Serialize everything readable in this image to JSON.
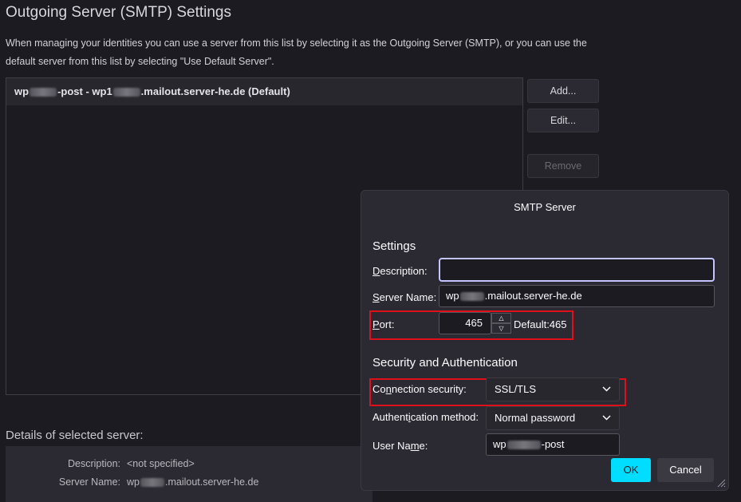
{
  "page": {
    "title": "Outgoing Server (SMTP) Settings",
    "intro": "When managing your identities you can use a server from this list by selecting it as the Outgoing Server (SMTP), or you can use the default server from this list by selecting \"Use Default Server\"."
  },
  "server_list": {
    "items": [
      {
        "prefix": "wp",
        "mid": "-post - wp1",
        "suffix": ".mailout.server-he.de (Default)"
      }
    ]
  },
  "side_buttons": {
    "add": "Add...",
    "edit": "Edit...",
    "remove": "Remove"
  },
  "details": {
    "heading": "Details of selected server:",
    "description_label": "Description:",
    "description_value": "<not specified>",
    "server_name_label": "Server Name:",
    "server_name_prefix": "wp",
    "server_name_suffix": ".mailout.server-he.de"
  },
  "dialog": {
    "title": "SMTP Server",
    "settings_heading": "Settings",
    "description_label_ul": "D",
    "description_label_rest": "escription:",
    "description_value": "",
    "server_name_label_ul": "S",
    "server_name_label_rest": "erver Name:",
    "server_name_prefix": "wp",
    "server_name_suffix": ".mailout.server-he.de",
    "port_label_ul": "P",
    "port_label_rest": "ort:",
    "port_value": "465",
    "port_default": "Default:465",
    "security_heading": "Security and Authentication",
    "conn_label_pre": "Co",
    "conn_label_ul": "n",
    "conn_label_rest": "nection security:",
    "conn_value": "SSL/TLS",
    "auth_label_pre": "Authent",
    "auth_label_ul": "i",
    "auth_label_rest": "cation method:",
    "auth_value": "Normal password",
    "user_label_pre": "User Na",
    "user_label_ul": "m",
    "user_label_rest": "e:",
    "user_prefix": "wp",
    "user_suffix": "-post",
    "ok": "OK",
    "cancel": "Cancel"
  },
  "colors": {
    "background": "#1c1b22",
    "dialog": "#2b2a33",
    "accent": "#00ddff",
    "highlight": "#e0101a"
  }
}
